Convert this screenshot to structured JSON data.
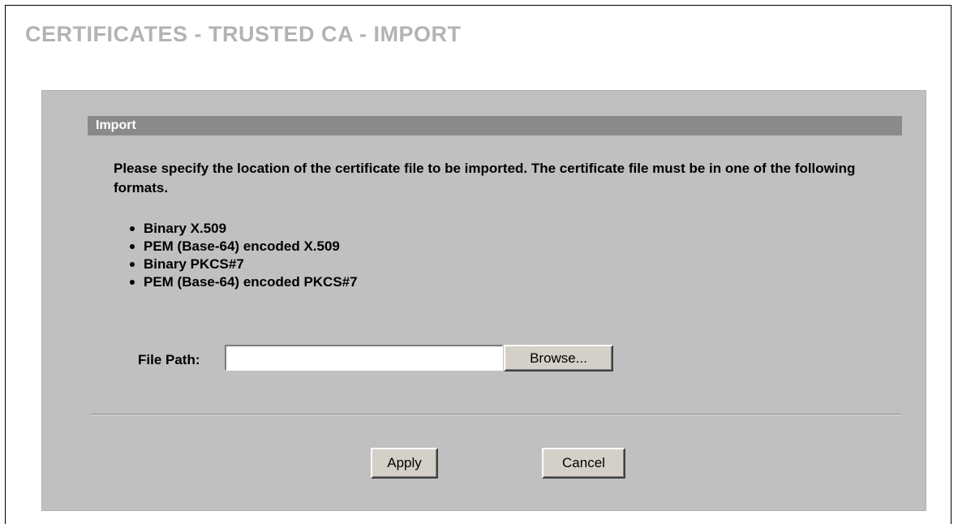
{
  "page_title": "CERTIFICATES - TRUSTED CA - IMPORT",
  "section": {
    "title": "Import",
    "instructions": "Please specify the location of the certificate file to be imported. The certificate file must be in one of the following formats.",
    "formats": [
      "Binary X.509",
      "PEM (Base-64) encoded X.509",
      "Binary PKCS#7",
      "PEM (Base-64) encoded PKCS#7"
    ]
  },
  "file_path": {
    "label": "File Path:",
    "value": "",
    "browse_label": "Browse..."
  },
  "actions": {
    "apply_label": "Apply",
    "cancel_label": "Cancel"
  },
  "colors": {
    "title": "#b3b3b3",
    "panel_bg": "#c0c0c0",
    "section_bar": "#8a8a8a",
    "button_face": "#d4d0c8"
  }
}
